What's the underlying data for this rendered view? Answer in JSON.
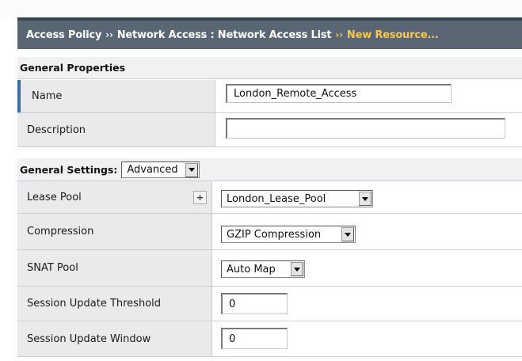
{
  "breadcrumb": {
    "items": [
      "Access Policy",
      "Network Access : Network Access List"
    ],
    "current": "New Resource...",
    "separator": "››"
  },
  "general_properties": {
    "title": "General Properties",
    "name_label": "Name",
    "name_value": "London_Remote_Access",
    "description_label": "Description",
    "description_value": ""
  },
  "general_settings": {
    "title": "General Settings:",
    "mode_value": "Advanced",
    "lease_pool_label": "Lease Pool",
    "lease_pool_add": "+",
    "lease_pool_value": "London_Lease_Pool",
    "compression_label": "Compression",
    "compression_value": "GZIP Compression",
    "snat_label": "SNAT Pool",
    "snat_value": "Auto Map",
    "threshold_label": "Session Update Threshold",
    "threshold_value": "0",
    "window_label": "Session Update Window",
    "window_value": "0"
  },
  "colors": {
    "breadcrumb_bg": "#5a6673",
    "breadcrumb_highlight": "#f7c74e",
    "label_bg": "#e9eaec",
    "row_marker": "#3a6ea5"
  }
}
